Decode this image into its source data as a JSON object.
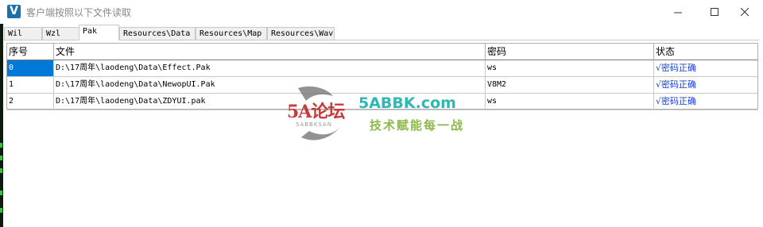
{
  "window": {
    "title": "客户端按照以下文件读取",
    "icon": "V"
  },
  "tabs": [
    {
      "label": "Wil"
    },
    {
      "label": "Wzl"
    },
    {
      "label": "Pak"
    },
    {
      "label": "Resources\\Data"
    },
    {
      "label": "Resources\\Map"
    },
    {
      "label": "Resources\\Wav"
    }
  ],
  "active_tab": "Pak",
  "table": {
    "headers": [
      "序号",
      "文件",
      "密码",
      "状态"
    ],
    "rows": [
      {
        "index": "0",
        "file": "D:\\17周年\\laodeng\\Data\\Effect.Pak",
        "password": "ws",
        "status": "√密码正确"
      },
      {
        "index": "1",
        "file": "D:\\17周年\\laodeng\\Data\\NewopUI.Pak",
        "password": "V8M2",
        "status": "√密码正确"
      },
      {
        "index": "2",
        "file": "D:\\17周年\\laodeng\\Data\\ZDYUI.pak",
        "password": "ws",
        "status": "√密码正确"
      }
    ]
  },
  "watermark": {
    "logo": "5A论坛",
    "sub": "5ABBKSAN",
    "site": "5ABBK.com",
    "slogan": "技术赋能每一战"
  },
  "colors": {
    "selection": "#0078d7",
    "status_text": "#1a3fd4",
    "left_strip": "#2fc43a"
  }
}
